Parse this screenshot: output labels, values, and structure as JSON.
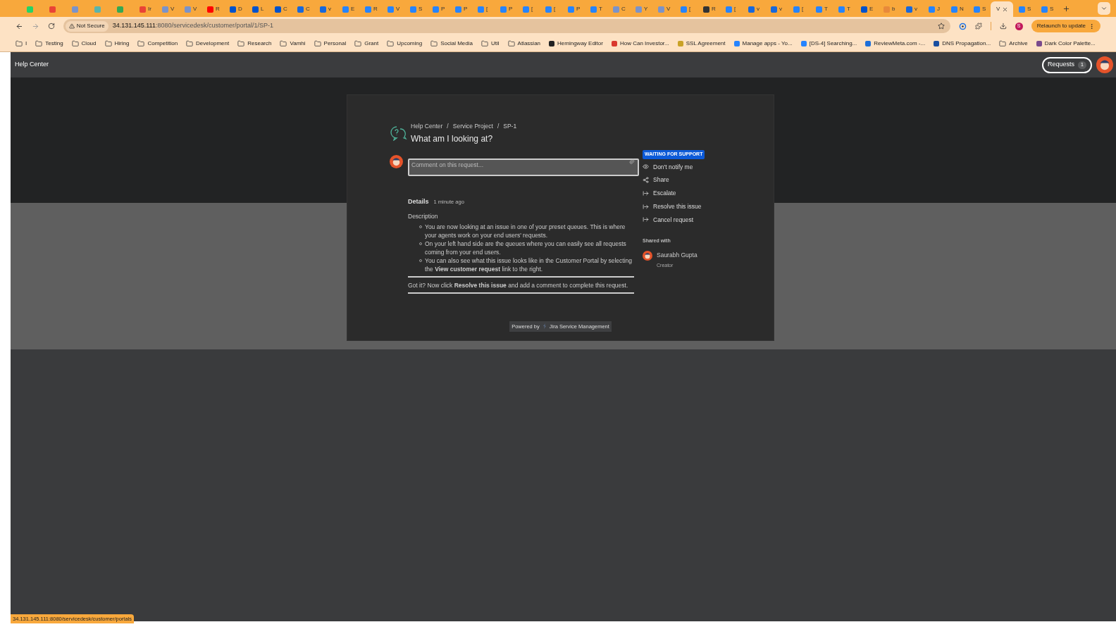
{
  "browser": {
    "tabs": [
      {
        "selected": false,
        "color": "#25d366"
      },
      {
        "selected": false,
        "color": "#ea4335"
      },
      {
        "selected": false,
        "color": "#7b93c9"
      },
      {
        "selected": false,
        "color": "#5ab4ac"
      },
      {
        "selected": false,
        "color": "#34a853"
      },
      {
        "label": "Ir",
        "selected": false,
        "color": "#ea4335"
      },
      {
        "label": "V",
        "selected": false,
        "color": "#7b93c9"
      },
      {
        "label": "V",
        "selected": false,
        "color": "#7b93c9"
      },
      {
        "label": "R",
        "selected": false,
        "color": "#ff0000"
      },
      {
        "label": "D",
        "selected": false,
        "color": "#0052cc"
      },
      {
        "label": "L",
        "selected": false,
        "color": "#0052cc"
      },
      {
        "label": "C",
        "selected": false,
        "color": "#0052cc"
      },
      {
        "label": "C",
        "selected": false,
        "color": "#1868db"
      },
      {
        "label": "v",
        "selected": false,
        "color": "#1868db"
      },
      {
        "label": "E",
        "selected": false,
        "color": "#2684ff"
      },
      {
        "label": "R",
        "selected": false,
        "color": "#2684ff"
      },
      {
        "label": "V",
        "selected": false,
        "color": "#2684ff"
      },
      {
        "label": "S",
        "selected": false,
        "color": "#2684ff"
      },
      {
        "label": "P",
        "selected": false,
        "color": "#2684ff"
      },
      {
        "label": "P",
        "selected": false,
        "color": "#2684ff"
      },
      {
        "label": "[",
        "selected": false,
        "color": "#2684ff"
      },
      {
        "label": "P",
        "selected": false,
        "color": "#2684ff"
      },
      {
        "label": "[",
        "selected": false,
        "color": "#2684ff"
      },
      {
        "label": "[",
        "selected": false,
        "color": "#2684ff"
      },
      {
        "label": "P",
        "selected": false,
        "color": "#2684ff"
      },
      {
        "label": "T",
        "selected": false,
        "color": "#2684ff"
      },
      {
        "label": "C",
        "selected": false,
        "color": "#7b93c9"
      },
      {
        "label": "Y",
        "selected": false,
        "color": "#7b93c9"
      },
      {
        "label": "V",
        "selected": false,
        "color": "#7b93c9"
      },
      {
        "label": "[",
        "selected": false,
        "color": "#2684ff"
      },
      {
        "label": "R",
        "selected": false,
        "color": "#333333"
      },
      {
        "label": "[",
        "selected": false,
        "color": "#2684ff"
      },
      {
        "label": "v",
        "selected": false,
        "color": "#1868db"
      },
      {
        "label": "v",
        "selected": false,
        "color": "#1868db"
      },
      {
        "label": "[",
        "selected": false,
        "color": "#2684ff"
      },
      {
        "label": "T",
        "selected": false,
        "color": "#2684ff"
      },
      {
        "label": "T",
        "selected": false,
        "color": "#2684ff"
      },
      {
        "label": "E",
        "selected": false,
        "color": "#0052cc"
      },
      {
        "label": "b",
        "selected": false,
        "color": "#e8893a"
      },
      {
        "label": "v",
        "selected": false,
        "color": "#1868db"
      },
      {
        "label": "J",
        "selected": false,
        "color": "#2684ff"
      },
      {
        "label": "N",
        "selected": false,
        "color": "#2684ff"
      },
      {
        "label": "S",
        "selected": false,
        "color": "#2684ff"
      },
      {
        "label": "V",
        "selected": true
      },
      {
        "label": "S",
        "selected": false,
        "color": "#2684ff"
      },
      {
        "label": "S",
        "selected": false,
        "color": "#2684ff"
      }
    ],
    "security_label": "Not Secure",
    "url_host": "34.131.145.111",
    "url_path": ":8080/servicedesk/customer/portal/1/SP-1",
    "profile_letter": "S",
    "relaunch_label": "Relaunch to update",
    "bookmarks": [
      {
        "kind": "folder",
        "label": "I"
      },
      {
        "kind": "folder",
        "label": "Testing"
      },
      {
        "kind": "folder",
        "label": "Cloud"
      },
      {
        "kind": "folder",
        "label": "Hiring"
      },
      {
        "kind": "folder",
        "label": "Competition"
      },
      {
        "kind": "folder",
        "label": "Development"
      },
      {
        "kind": "folder",
        "label": "Research"
      },
      {
        "kind": "folder",
        "label": "Vamhi"
      },
      {
        "kind": "folder",
        "label": "Personal"
      },
      {
        "kind": "folder",
        "label": "Grant"
      },
      {
        "kind": "folder",
        "label": "Upcoming"
      },
      {
        "kind": "folder",
        "label": "Social Media"
      },
      {
        "kind": "folder",
        "label": "Util"
      },
      {
        "kind": "folder",
        "label": "Atlassian"
      },
      {
        "kind": "page",
        "label": "Hemingway Editor",
        "color": "#222222"
      },
      {
        "kind": "page",
        "label": "How Can Investor...",
        "color": "#d9382e"
      },
      {
        "kind": "page",
        "label": "SSL Agreement",
        "color": "#c9a227"
      },
      {
        "kind": "page",
        "label": "Manage apps - Yo...",
        "color": "#2684ff"
      },
      {
        "kind": "page",
        "label": "[DS-4] Searching...",
        "color": "#2684ff"
      },
      {
        "kind": "page",
        "label": "ReviewMeta.com -...",
        "color": "#1e6fd9"
      },
      {
        "kind": "page",
        "label": "DNS Propagation...",
        "color": "#1a4fa0"
      },
      {
        "kind": "folder",
        "label": "Archive"
      },
      {
        "kind": "page",
        "label": "Dark Color Palette...",
        "color": "#7a4a8c"
      }
    ]
  },
  "portal_header": {
    "title": "Help Center",
    "requests_label": "Requests",
    "requests_count": "1"
  },
  "request": {
    "breadcrumbs": [
      {
        "label": "Help Center"
      },
      {
        "label": "Service Project"
      },
      {
        "label": "SP-1"
      }
    ],
    "separator": "/",
    "title": "What am I looking at?",
    "comment_placeholder": "Comment on this request...",
    "details_label": "Details",
    "time": "1 minute ago",
    "description_label": "Description",
    "bullets": [
      "You are now looking at an issue in one of your preset queues. This is where your agents work on your end users' requests.",
      "On your left hand side are the queues where you can easily see all requests coming from your end users.",
      "You can also see what this issue looks like in the Customer Portal by selecting the **View customer request** link to the right."
    ],
    "note": "Got it? Now click **Resolve this issue** and add a comment to complete this request.",
    "status": "WAITING FOR SUPPORT",
    "actions": [
      {
        "kind": "watch",
        "label": "Don't notify me"
      },
      {
        "kind": "share",
        "label": "Share"
      },
      {
        "kind": "transition",
        "label": "Escalate"
      },
      {
        "kind": "transition",
        "label": "Resolve this issue"
      },
      {
        "kind": "transition",
        "label": "Cancel request"
      }
    ],
    "shared_with_label": "Shared with",
    "participants": [
      {
        "name": "Saurabh Gupta",
        "role": "Creator"
      }
    ]
  },
  "footer": {
    "powered_by": "Powered by",
    "product": "Jira Service Management"
  },
  "status_bar": {
    "url": "34.131.145.111:8080/servicedesk/customer/portals"
  }
}
